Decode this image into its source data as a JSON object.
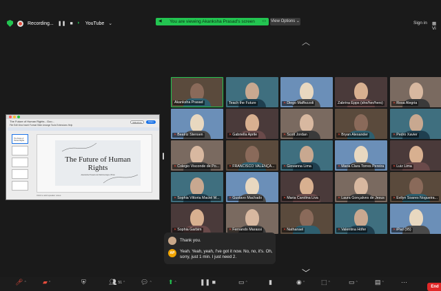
{
  "topbar": {
    "recording_label": "Recording...",
    "pause_icon": "pause-icon",
    "stop_icon": "stop-icon",
    "youtube_label": "YouTube",
    "viewing_banner": "You are viewing Akanksha Prasad's screen",
    "view_options": "View Options",
    "sign_in": "Sign in",
    "view_label": "Vi"
  },
  "shared_screen": {
    "doc_title": "The Future of Human Rights - Goo...",
    "menu": "File  Edit  View  Insert  Format  Slide  Arrange  Tools  Extensions  Help",
    "slideshow": "Slideshow",
    "share": "Share",
    "thumbs": [
      "The Future of Human Rights",
      "",
      "",
      ""
    ],
    "slide_title": "The Future of Human Rights",
    "slide_subtitle": "Akanksha Prasad and Zabrina Epps (TFH)",
    "notes": "Click to add speaker notes"
  },
  "participants": [
    {
      "name": "Akanksha Prasad",
      "muted": false,
      "speaking": true
    },
    {
      "name": "Teach the Future",
      "muted": false
    },
    {
      "name": "Diego Maffezzoli",
      "muted": true
    },
    {
      "name": "Zabrina Epps (she/her/hers)",
      "muted": false
    },
    {
      "name": "Rosa Alegria",
      "muted": true
    },
    {
      "name": "Beatriz Stensen",
      "muted": true
    },
    {
      "name": "Gabriella Aprile",
      "muted": true
    },
    {
      "name": "Scott Jordan",
      "muted": true
    },
    {
      "name": "Bryan Alexander",
      "muted": true
    },
    {
      "name": "Pedro Xavier",
      "muted": true
    },
    {
      "name": "Colegio Visconde de Po...",
      "muted": true
    },
    {
      "name": "FRANCISCO VALENÇA...",
      "muted": true
    },
    {
      "name": "Giovanna Lima",
      "muted": true
    },
    {
      "name": "Maria Clara Torres Pereira",
      "muted": true
    },
    {
      "name": "Luiz Lima",
      "muted": true
    },
    {
      "name": "Sophia Vittoria Maciel M...",
      "muted": true
    },
    {
      "name": "Gustavo Machado",
      "muted": true
    },
    {
      "name": "Maria Carolina Liva",
      "muted": true
    },
    {
      "name": "Laura Gonçalves de Jesus",
      "muted": true
    },
    {
      "name": "Evilyn Soares Nogueira...",
      "muted": true
    },
    {
      "name": "Sophia Garbim",
      "muted": true
    },
    {
      "name": "Fernando Marassi",
      "muted": true
    },
    {
      "name": "Nathanael",
      "muted": true
    },
    {
      "name": "Valentina Höfer",
      "muted": true
    },
    {
      "name": "iPad (95)",
      "muted": true
    }
  ],
  "chat": {
    "messages": [
      {
        "text": "Thank you."
      },
      {
        "initials": "AP",
        "text": "Yeah. Yeah, yeah, I've got it now. No, no, it's. Oh, sorry, just 1 min. I just need 2."
      }
    ]
  },
  "toolbar": {
    "participants_count": "51",
    "end_label": "End"
  },
  "colors": {
    "zoom_green": "#23c551",
    "end_red": "#e02828",
    "mute_red": "#e74c3c"
  }
}
